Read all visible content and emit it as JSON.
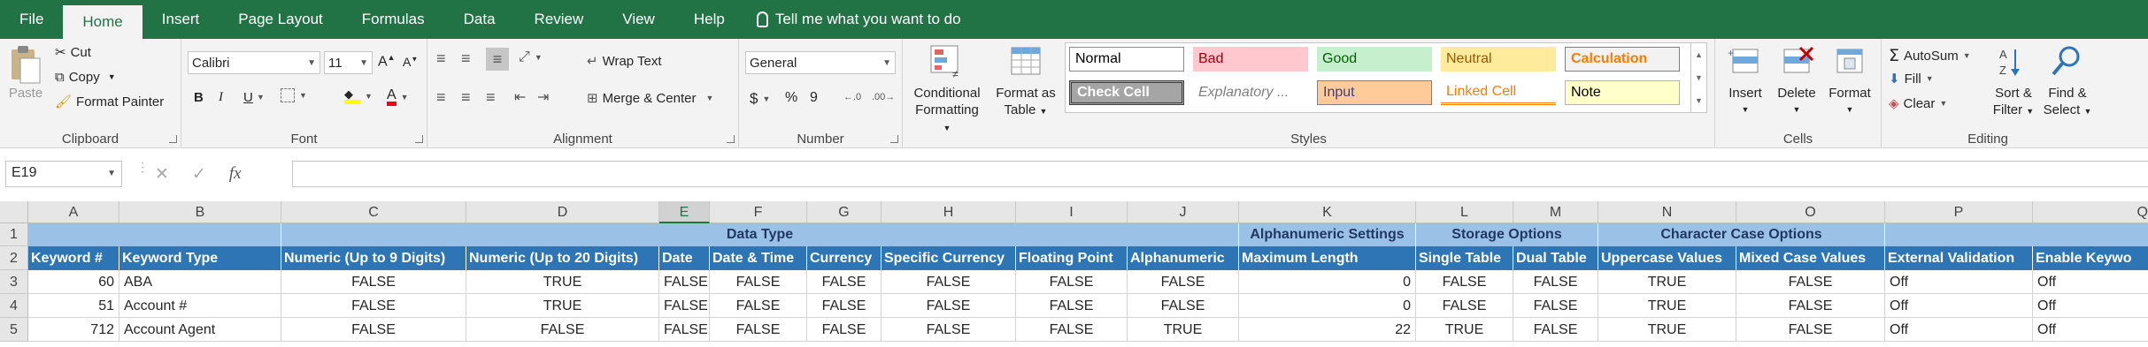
{
  "menu": {
    "tabs": [
      "File",
      "Home",
      "Insert",
      "Page Layout",
      "Formulas",
      "Data",
      "Review",
      "View",
      "Help"
    ],
    "tell_me": "Tell me what you want to do"
  },
  "ribbon": {
    "clipboard": {
      "paste": "Paste",
      "cut": "Cut",
      "copy": "Copy",
      "format_painter": "Format Painter",
      "label": "Clipboard"
    },
    "font": {
      "family": "Calibri",
      "size": "11",
      "bold": "B",
      "italic": "I",
      "underline": "U",
      "label": "Font"
    },
    "alignment": {
      "wrap_text": "Wrap Text",
      "merge_center": "Merge & Center",
      "label": "Alignment"
    },
    "number": {
      "format": "General",
      "currency": "$",
      "percent": "%",
      "comma": "9",
      "label": "Number"
    },
    "styles": {
      "conditional": [
        "Conditional",
        "Formatting"
      ],
      "format_table": [
        "Format as",
        "Table"
      ],
      "cells": [
        "Normal",
        "Bad",
        "Good",
        "Neutral",
        "Calculation",
        "Check Cell",
        "Explanatory ...",
        "Input",
        "Linked Cell",
        "Note"
      ],
      "label": "Styles"
    },
    "cells": {
      "insert": "Insert",
      "delete": "Delete",
      "format": "Format",
      "label": "Cells"
    },
    "editing": {
      "autosum": "AutoSum",
      "fill": "Fill",
      "clear": "Clear",
      "sort_filter": [
        "Sort &",
        "Filter"
      ],
      "find_select": [
        "Find &",
        "Select"
      ],
      "label": "Editing"
    }
  },
  "formula_bar": {
    "name_box": "E19",
    "fx": "fx",
    "content": ""
  },
  "sheet": {
    "columns": [
      "A",
      "B",
      "C",
      "D",
      "E",
      "F",
      "G",
      "H",
      "I",
      "J",
      "K",
      "L",
      "M",
      "N",
      "O",
      "P",
      "Q"
    ],
    "selected_column": "E",
    "rows": [
      "1",
      "2",
      "3",
      "4",
      "5"
    ],
    "group_headers": [
      "Data Type",
      "Alphanumeric Settings",
      "Storage Options",
      "Character Case Options"
    ],
    "headers": [
      "Keyword #",
      "Keyword Type",
      "Numeric (Up to 9 Digits)",
      "Numeric (Up to 20 Digits)",
      "Date",
      "Date & Time",
      "Currency",
      "Specific Currency",
      "Floating Point",
      "Alphanumeric",
      "Maximum Length",
      "Single Table",
      "Dual Table",
      "Uppercase Values",
      "Mixed Case Values",
      "External Validation",
      "Enable Keywo"
    ],
    "data": [
      [
        "60",
        "ABA",
        "FALSE",
        "TRUE",
        "FALSE",
        "FALSE",
        "FALSE",
        "FALSE",
        "FALSE",
        "FALSE",
        "0",
        "FALSE",
        "FALSE",
        "TRUE",
        "FALSE",
        "Off",
        "Off"
      ],
      [
        "51",
        "Account #",
        "FALSE",
        "TRUE",
        "FALSE",
        "FALSE",
        "FALSE",
        "FALSE",
        "FALSE",
        "FALSE",
        "0",
        "FALSE",
        "FALSE",
        "TRUE",
        "FALSE",
        "Off",
        "Off"
      ],
      [
        "712",
        "Account Agent",
        "FALSE",
        "FALSE",
        "FALSE",
        "FALSE",
        "FALSE",
        "FALSE",
        "FALSE",
        "TRUE",
        "22",
        "TRUE",
        "FALSE",
        "TRUE",
        "FALSE",
        "Off",
        "Off"
      ]
    ]
  },
  "colors": {
    "brand": "#217346",
    "band": "#9bc2e6",
    "header": "#2e75b6"
  }
}
